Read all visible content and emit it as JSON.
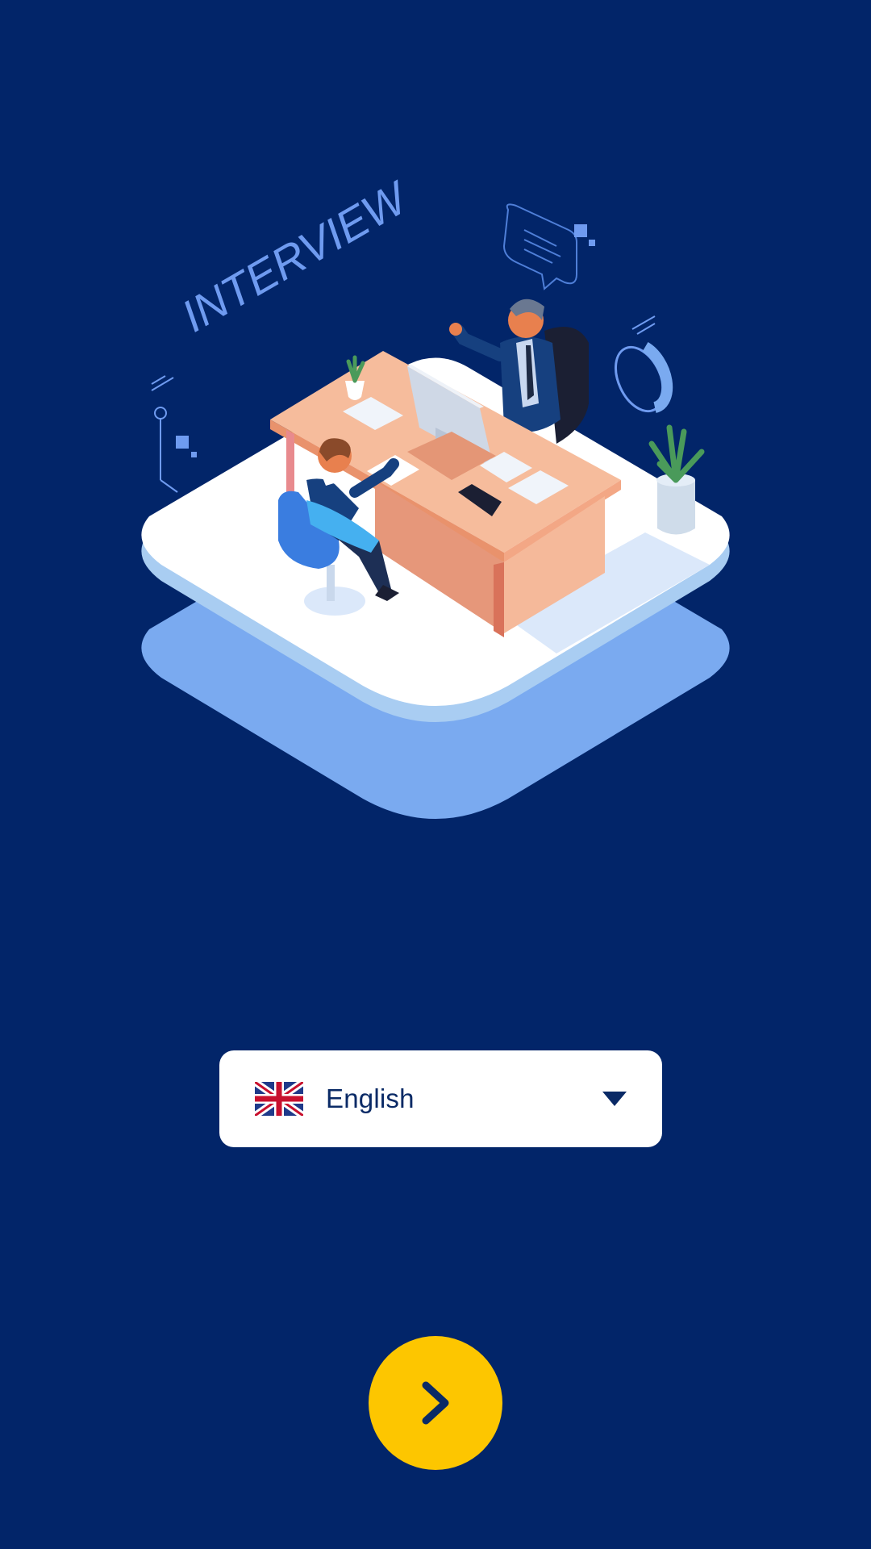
{
  "illustration": {
    "headline": "INTERVIEW"
  },
  "language_select": {
    "flag_icon": "uk-flag-icon",
    "selected": "English",
    "caret_icon": "caret-down-icon"
  },
  "next_button": {
    "icon": "chevron-right-icon"
  },
  "colors": {
    "background": "#022569",
    "accent": "#fdc600",
    "select_text": "#0a2a66"
  }
}
